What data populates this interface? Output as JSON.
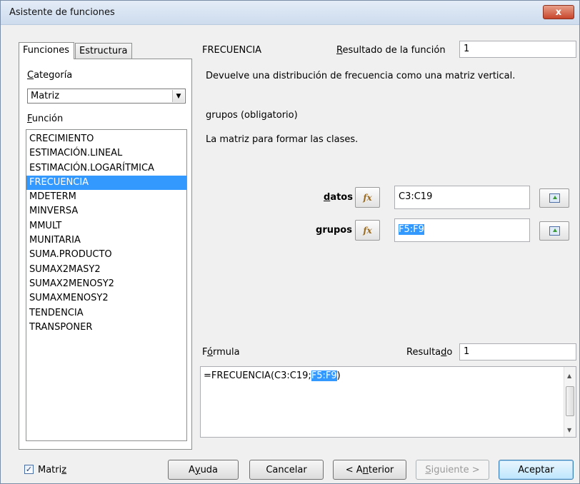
{
  "window": {
    "title": "Asistente de funciones",
    "close_label": "x"
  },
  "tabs": [
    {
      "label": "Funciones"
    },
    {
      "label": "Estructura"
    }
  ],
  "left_panel": {
    "category_label": "Categoría",
    "category_value": "Matriz",
    "function_label": "Función",
    "functions": [
      "CRECIMIENTO",
      "ESTIMACIÓN.LINEAL",
      "ESTIMACIÓN.LOGARÍTMICA",
      "FRECUENCIA",
      "MDETERM",
      "MINVERSA",
      "MMULT",
      "MUNITARIA",
      "SUMA.PRODUCTO",
      "SUMAX2MASY2",
      "SUMAX2MENOSY2",
      "SUMAXMENOSY2",
      "TENDENCIA",
      "TRANSPONER"
    ],
    "selected_index": 3
  },
  "right_panel": {
    "function_name": "FRECUENCIA",
    "result_label": "Resultado de la función",
    "result_value": "1",
    "description": "Devuelve una distribución de frecuencia como una matriz vertical.",
    "param_title": "grupos (obligatorio)",
    "param_description": "La matriz para formar las clases.",
    "args": [
      {
        "label": "datos",
        "value": "C3:C19"
      },
      {
        "label": "grupos",
        "value": "F5:F9"
      }
    ],
    "formula_label": "Fórmula",
    "result2_label": "Resultado",
    "result2_value": "1",
    "formula_prefix": "=FRECUENCIA(C3:C19;",
    "formula_selected": "F5:F9",
    "formula_suffix": ")"
  },
  "footer": {
    "checkbox_label": "Matriz",
    "checkbox_checked": true,
    "buttons": {
      "help": "Ayuda",
      "cancel": "Cancelar",
      "back": "< Anterior",
      "next": "Siguiente >",
      "ok": "Aceptar"
    }
  }
}
